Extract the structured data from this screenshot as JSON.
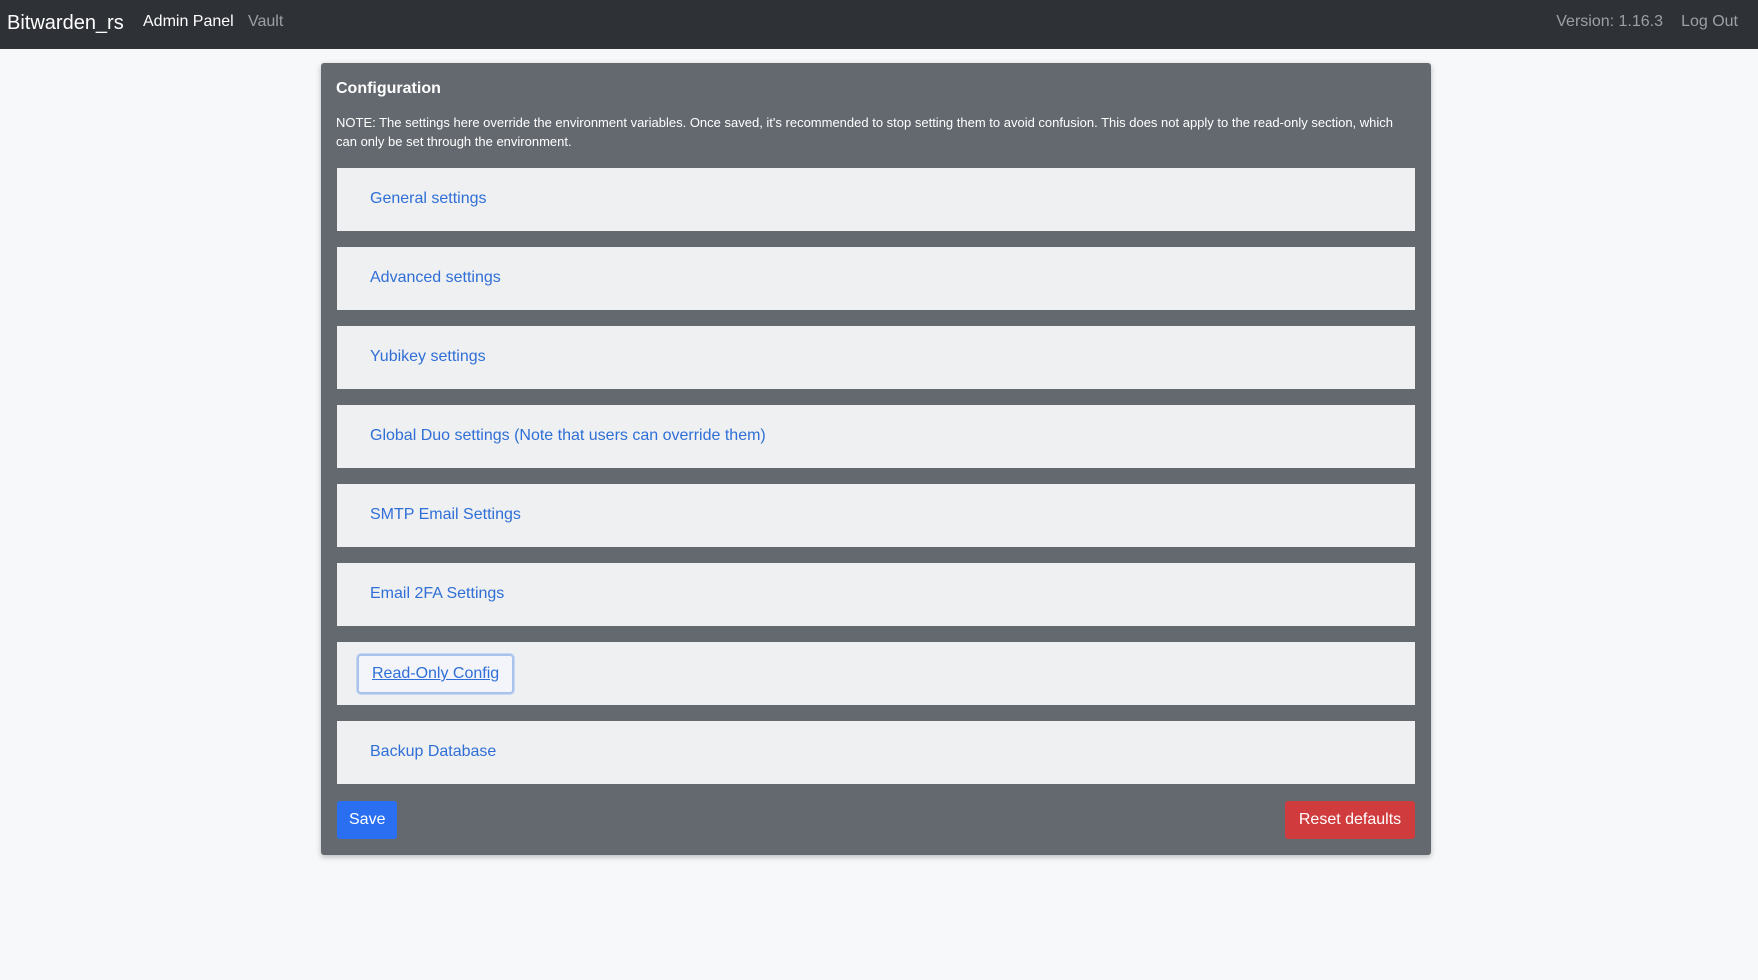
{
  "navbar": {
    "brand": "Bitwarden_rs",
    "admin_panel": "Admin Panel",
    "vault": "Vault",
    "version": "Version: 1.16.3",
    "logout": "Log Out"
  },
  "config": {
    "title": "Configuration",
    "note": "NOTE: The settings here override the environment variables. Once saved, it's recommended to stop setting them to avoid confusion. This does not apply to the read-only section, which can only be set through the environment.",
    "sections": [
      {
        "label": "General settings"
      },
      {
        "label": "Advanced settings"
      },
      {
        "label": "Yubikey settings"
      },
      {
        "label": "Global Duo settings (Note that users can override them)"
      },
      {
        "label": "SMTP Email Settings"
      },
      {
        "label": "Email 2FA Settings"
      },
      {
        "label": "Read-Only Config"
      },
      {
        "label": "Backup Database"
      }
    ],
    "save_label": "Save",
    "reset_label": "Reset defaults"
  },
  "colors": {
    "navbar_bg": "#2e3136",
    "card_bg": "#646970",
    "link": "#2f6fd7",
    "save": "#2a6ff2",
    "reset": "#d03c3e"
  }
}
